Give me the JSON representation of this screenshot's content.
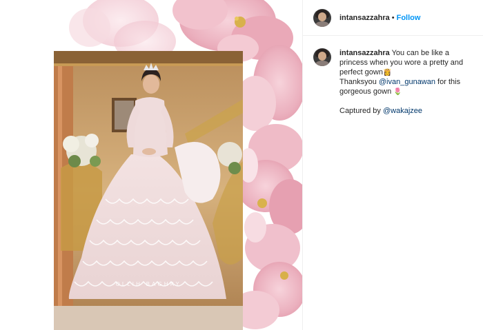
{
  "post": {
    "photo_watermark": "OLLIH BAGHRY"
  },
  "header": {
    "username": "intansazzahra",
    "separator": "•",
    "follow_label": "Follow"
  },
  "caption": {
    "username": "intansazzahra",
    "line1_text": "You can be like a princess when you wore a pretty and perfect gown",
    "line1_emoji": "👸",
    "line2_prefix": "Thanksyou ",
    "line2_mention": "@ivan_gunawan",
    "line2_suffix": " for this gorgeous gown ",
    "line2_emoji": "🌷",
    "line3_prefix": "Captured by ",
    "line3_mention": "@wakajzee"
  },
  "colors": {
    "link_blue": "#0095f6",
    "mention_blue": "#00376b",
    "text": "#262626",
    "divider": "#efefef"
  },
  "icons": {
    "avatar": "profile-avatar",
    "princess_emoji": "princess-icon",
    "flower_emoji": "flower-icon"
  }
}
